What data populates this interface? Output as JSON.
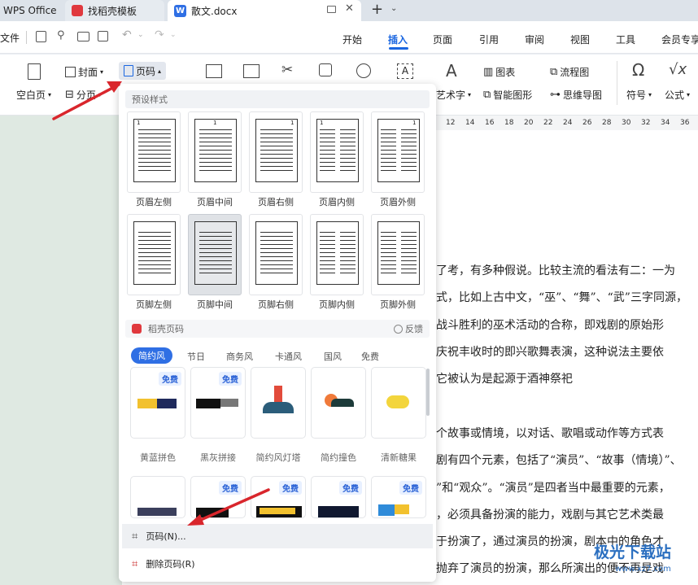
{
  "window_tabs": [
    {
      "label": "WPS Office"
    },
    {
      "label": "找稻壳模板"
    },
    {
      "label": "散文.docx"
    }
  ],
  "toolbar": {
    "file_label": "文件",
    "menu_tabs": [
      "开始",
      "插入",
      "页面",
      "引用",
      "审阅",
      "视图",
      "工具",
      "会员专享"
    ],
    "active_tab": "插入"
  },
  "ribbon": {
    "blank_page": "空白页",
    "cover": "封面",
    "page_break": "分页",
    "page_number": "页码",
    "art_text": "艺术字",
    "chart": "图表",
    "smart_graphic": "智能图形",
    "flowchart": "流程图",
    "mindmap": "思维导图",
    "symbol": "符号",
    "formula": "公式"
  },
  "ruler_ticks": [
    "12",
    "14",
    "16",
    "18",
    "20",
    "22",
    "24",
    "26",
    "28",
    "30",
    "32",
    "34",
    "36"
  ],
  "document_lines": [
    "了考，有多种假说。比较主流的看法有二：一为",
    "式，比如上古中文，“巫”、“舞”、“武”三字同源，",
    "战斗胜利的巫术活动的合称，即戏剧的原始形",
    "庆祝丰收时的即兴歌舞表演，这种说法主要依",
    "它被认为是起源于酒神祭祀",
    "",
    "个故事或情境，以对话、歌唱或动作等方式表",
    "剧有四个元素，包括了“演员”、“故事（情境）”、",
    "”和“观众”。“演员”是四者当中最重要的元素，",
    "，必须具备扮演的能力，戏剧与其它艺术类最",
    "于扮演了，通过演员的扮演，剧本中的角色才",
    "抛弃了演员的扮演，那么所演出的便不再是戏"
  ],
  "dropdown": {
    "preset_header": "预设样式",
    "header_styles": [
      "页眉左侧",
      "页眉中间",
      "页眉右侧",
      "页眉内侧",
      "页眉外侧"
    ],
    "footer_styles": [
      "页脚左侧",
      "页脚中间",
      "页脚右侧",
      "页脚内侧",
      "页脚外侧"
    ],
    "selected_style": "页脚中间",
    "sample_number": "1",
    "docer_header": "稻壳页码",
    "feedback": "反馈",
    "categories": [
      "简约风",
      "节日",
      "商务风",
      "卡通风",
      "国风",
      "免费"
    ],
    "active_category": "简约风",
    "free_badge": "免费",
    "templates_row1": [
      "黄蓝拼色",
      "黑灰拼接",
      "简约风灯塔",
      "简约撞色",
      "清新糖果"
    ],
    "menu_page_number": "页码(N)...",
    "menu_delete_page_number": "删除页码(R)"
  },
  "watermark": {
    "text": "极光下载站",
    "url": "www.xz7.com"
  },
  "colors": {
    "accent": "#1a66e0",
    "arrow": "#d9262c"
  }
}
